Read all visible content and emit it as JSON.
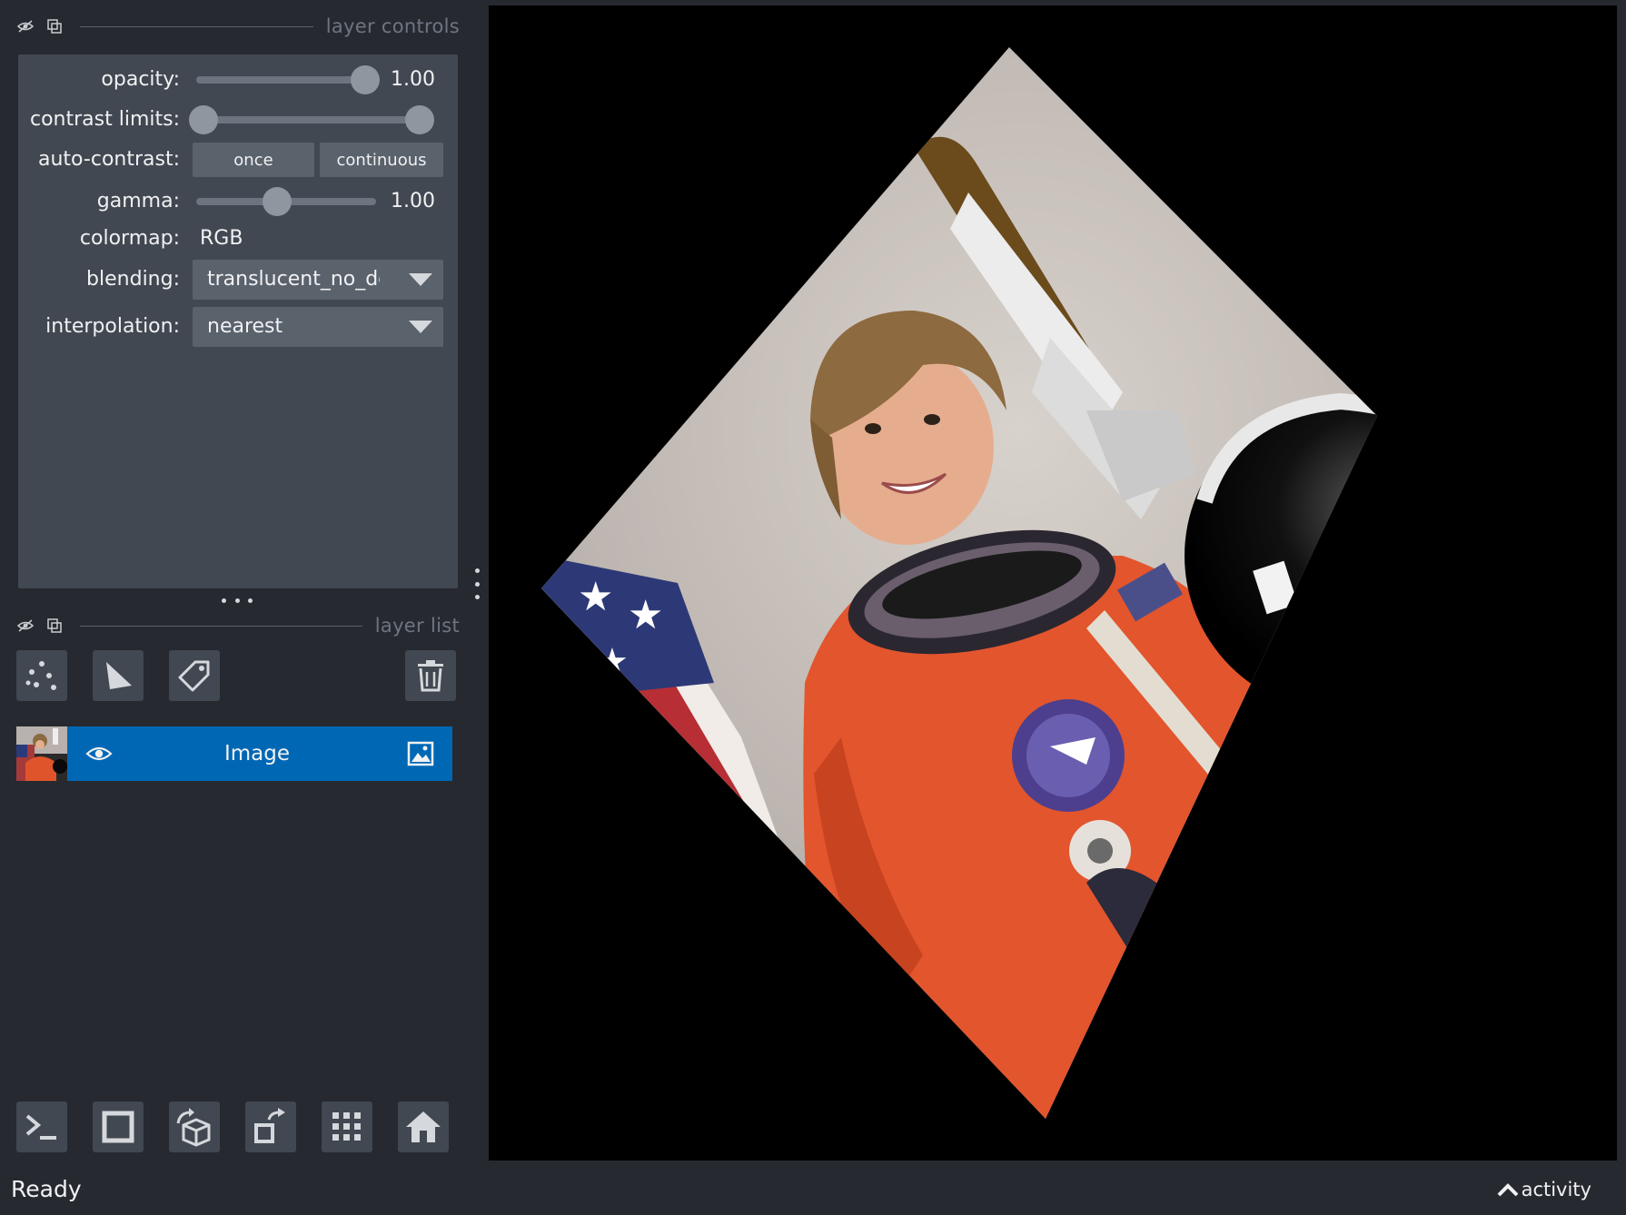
{
  "layer_controls": {
    "title": "layer controls",
    "opacity": {
      "label": "opacity:",
      "value": "1.00",
      "level": 1.0
    },
    "contrast_limits": {
      "label": "contrast limits:",
      "low": 0.0,
      "high": 1.0
    },
    "auto_contrast": {
      "label": "auto-contrast:",
      "once": "once",
      "continuous": "continuous"
    },
    "gamma": {
      "label": "gamma:",
      "value": "1.00",
      "level": 0.45
    },
    "colormap": {
      "label": "colormap:",
      "value": "RGB"
    },
    "blending": {
      "label": "blending:",
      "value": "translucent_no_depth"
    },
    "interpolation": {
      "label": "interpolation:",
      "value": "nearest"
    }
  },
  "layer_list": {
    "title": "layer list",
    "layers": [
      {
        "name": "Image",
        "type": "image",
        "visible": true,
        "selected": true
      }
    ]
  },
  "status": {
    "text": "Ready",
    "activity": "activity"
  },
  "colors": {
    "accent": "#0067b5",
    "panel": "#414851",
    "background": "#262930"
  }
}
